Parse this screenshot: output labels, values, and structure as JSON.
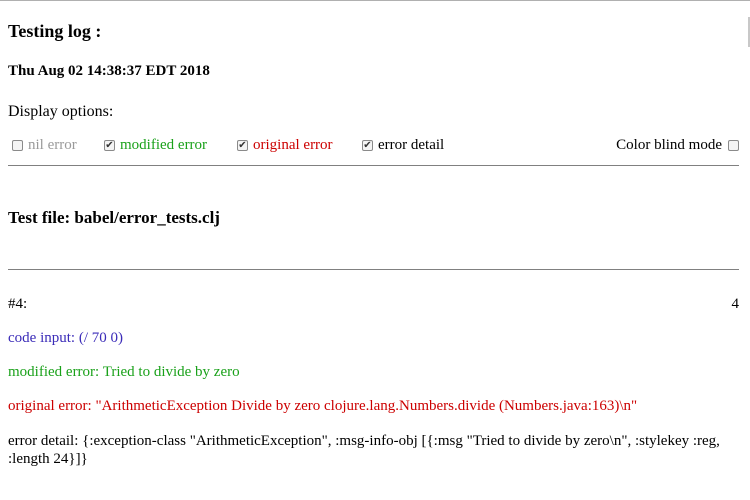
{
  "header": {
    "title": "Testing log :",
    "date": "Thu Aug 02 14:38:37 EDT 2018"
  },
  "display_options": {
    "label": "Display options:",
    "options": [
      {
        "label": "nil error",
        "checked": false,
        "color": "#9a9a9a"
      },
      {
        "label": "modified error",
        "checked": true,
        "color": "#1aa11a"
      },
      {
        "label": "original error",
        "checked": true,
        "color": "#cc0000"
      },
      {
        "label": "error detail",
        "checked": true,
        "color": "#000000"
      }
    ],
    "color_blind": {
      "label": "Color blind mode",
      "checked": false
    }
  },
  "test_file": {
    "title": "Test file: babel/error_tests.clj"
  },
  "entry": {
    "id": "#4:",
    "count": "4",
    "code_input": "code input: (/ 70 0)",
    "modified_error": "modified error: Tried to divide by zero",
    "original_error": "original error: \"ArithmeticException Divide by zero clojure.lang.Numbers.divide (Numbers.java:163)\\n\"",
    "error_detail": "error detail: {:exception-class \"ArithmeticException\", :msg-info-obj [{:msg \"Tried to divide by zero\\n\", :stylekey :reg, :length 24}]}"
  },
  "colors": {
    "code_input": "#3a2bb8",
    "modified": "#1aa11a",
    "original": "#cc0000",
    "nil": "#9a9a9a"
  }
}
